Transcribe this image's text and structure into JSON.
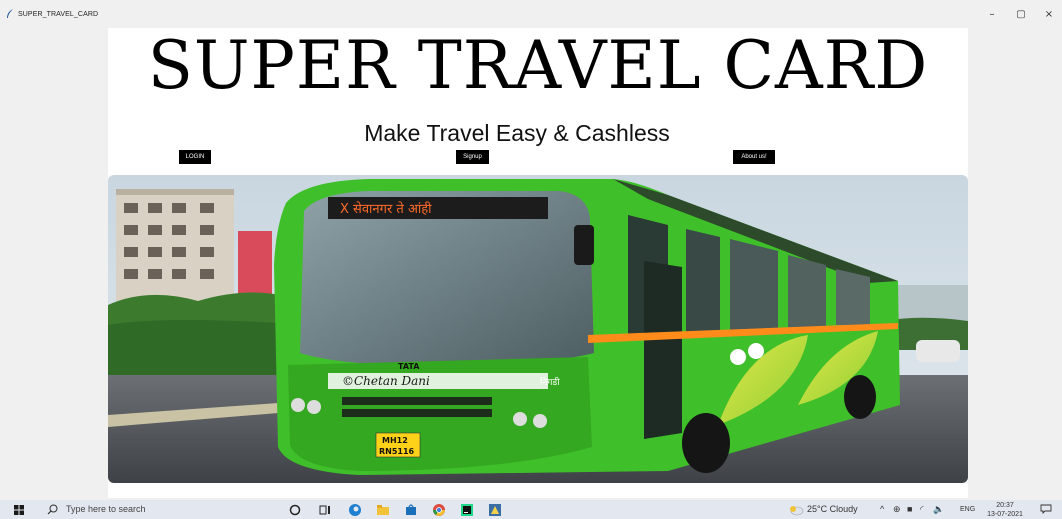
{
  "window": {
    "title": "SUPER_TRAVEL_CARD",
    "minimize": "–",
    "maximize": "▢",
    "close": "×"
  },
  "app": {
    "heading": "SUPER TRAVEL CARD",
    "tagline": "Make Travel Easy & Cashless",
    "buttons": {
      "login": "LOGIN",
      "signup": "Signup",
      "about": "About us!"
    },
    "hero_image": {
      "icon": "bus-photo",
      "bus_sign": "X सेवानगर ते आंही",
      "logo_text": "TATA",
      "side_text": "निगडी",
      "watermark": "©Chetan Dani",
      "plate_line1": "MH12",
      "plate_line2": "RN5116"
    }
  },
  "taskbar": {
    "search_placeholder": "Type here to search",
    "weather": "25°C  Cloudy",
    "language": "ENG",
    "time": "20:37",
    "date": "13-07-2021"
  },
  "colors": {
    "bus_green": "#3fbf2a",
    "bus_dark": "#1d2d1b",
    "button_bg": "#000000",
    "taskbar_bg": "#e3e7ef"
  }
}
